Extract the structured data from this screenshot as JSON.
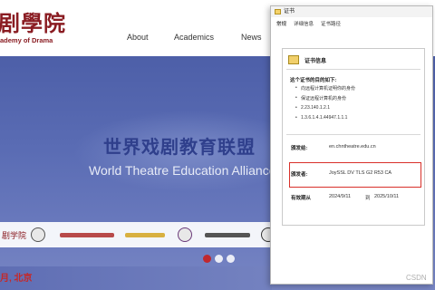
{
  "header": {
    "logo_cn": "剧學院",
    "logo_en": "ademy of Drama",
    "nav": [
      "About",
      "Academics",
      "News"
    ]
  },
  "hero": {
    "title_cn": "世界戏剧教育联盟",
    "title_en": "World Theatre Education Alliance",
    "footer_text": "月, 北京",
    "partners": [
      {
        "label": "剧学院",
        "icon": "school-seal-icon"
      },
      {
        "label": "",
        "icon": "emblem-icon"
      },
      {
        "label": "",
        "icon": "logo-wordmark-icon"
      },
      {
        "label": "",
        "icon": "logo-wordmark-icon"
      },
      {
        "label": "",
        "icon": "logo-wordmark-icon"
      },
      {
        "label": "",
        "icon": "emblem-icon"
      },
      {
        "label": "",
        "icon": "logo-wordmark-icon"
      },
      {
        "label": "",
        "icon": "emblem-icon"
      }
    ],
    "slide_count": 3,
    "active_slide": 0
  },
  "cert_dialog": {
    "title": "证书",
    "tabs": [
      "常规",
      "详细信息",
      "证书路径"
    ],
    "active_tab": 0,
    "header_title": "证书信息",
    "purpose_heading": "这个证书的目的如下:",
    "purposes": [
      "向远程计算机证明你的身份",
      "保证远程计算机的身份",
      "2.23.140.1.2.1",
      "1.3.6.1.4.1.44947.1.1.1"
    ],
    "issued_to_label": "颁发给:",
    "issued_to": "en.chntheatre.edu.cn",
    "issued_by_label": "颁发者:",
    "issued_by": "JoySSL DV TLS G2 R53 CA",
    "validity_label": "有效期从",
    "valid_from": "2024/9/11",
    "validity_to_word": "到",
    "valid_to": "2025/10/11"
  },
  "watermark": "CSDN"
}
